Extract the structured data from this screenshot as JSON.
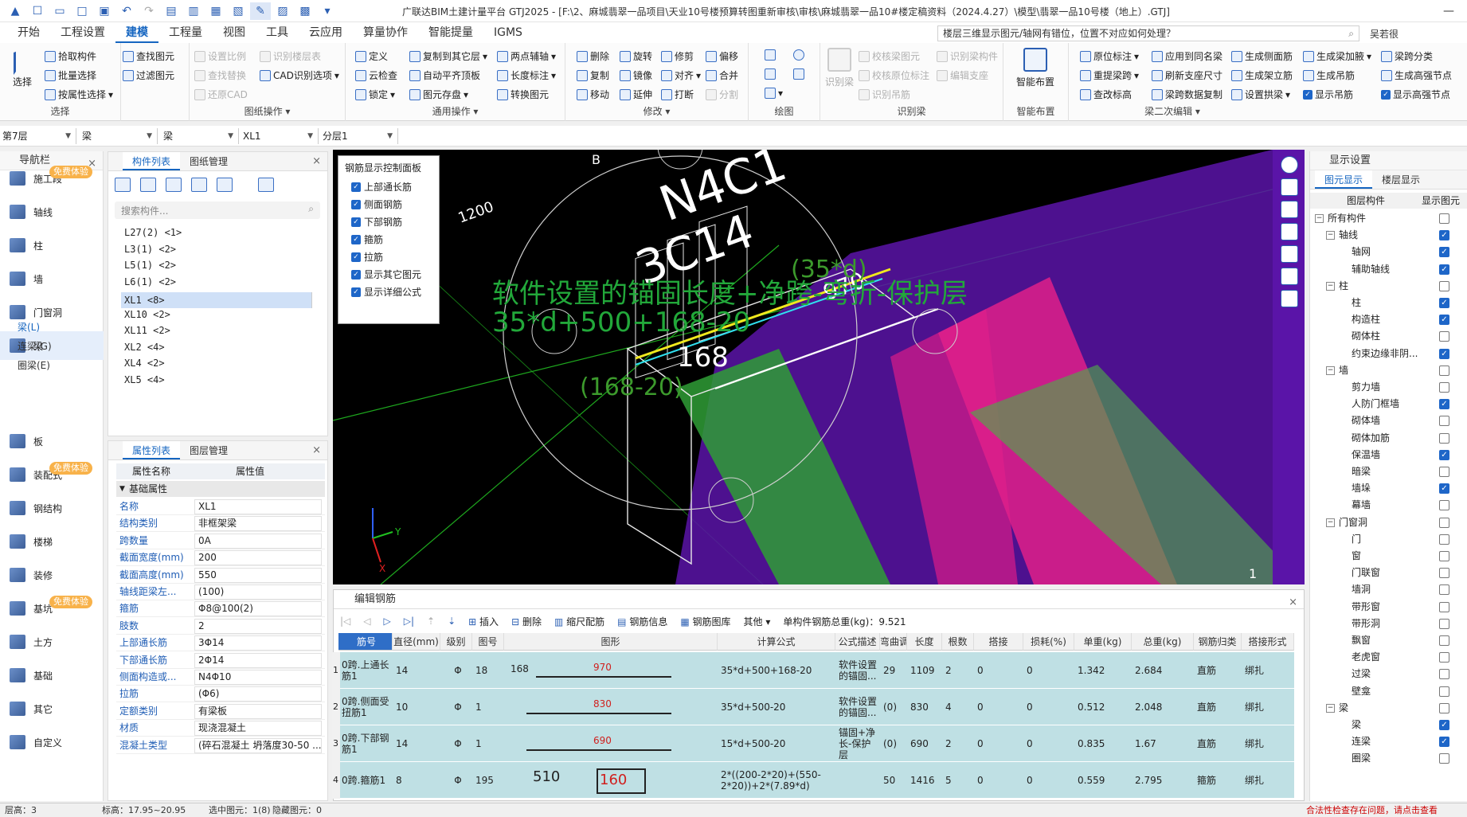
{
  "titlebar": {
    "title": "广联达BIM土建计量平台 GTJ2025 - [F:\\2、麻城翡翠一品项目\\天业10号楼预算转图重新审核\\审核\\麻城翡翠一品10#楼定稿资料（2024.4.27）\\模型\\翡翠一品10号楼（地上）.GTJ]"
  },
  "menubar": {
    "items": [
      "开始",
      "工程设置",
      "建模",
      "工程量",
      "视图",
      "工具",
      "云应用",
      "算量协作",
      "智能提量",
      "IGMS"
    ],
    "notice": "楼层三维显示图元/轴网有错位，位置不对应如何处理？",
    "user": "吴若很"
  },
  "ribbon": {
    "select": {
      "label": "选择",
      "pick": "拾取构件",
      "batch": "批量选择",
      "by_attr": "按属性选择",
      "select": "选择"
    },
    "find": {
      "find": "查找图元",
      "filter": "过滤图元"
    },
    "drawing": {
      "label": "图纸操作",
      "set_scale": "设置比例",
      "find_replace": "查找替换",
      "restore_cad": "还原CAD",
      "recognize_layer": "识别楼层表",
      "cad_option": "CAD识别选项"
    },
    "general": {
      "label": "通用操作",
      "define": "定义",
      "cloud_check": "云检查",
      "lock": "锁定",
      "copy_floor": "复制到其它层",
      "auto_flat": "自动平齐顶板",
      "save_elem": "图元存盘",
      "two_point": "两点辅轴",
      "length_mark": "长度标注",
      "convert": "转换图元"
    },
    "modify": {
      "label": "修改",
      "delete": "删除",
      "rotate": "旋转",
      "trim": "修剪",
      "offset": "偏移",
      "copy": "复制",
      "mirror": "镜像",
      "align": "对齐",
      "merge": "合并",
      "move": "移动",
      "extend": "延伸",
      "break": "打断",
      "split": "分割"
    },
    "draw": {
      "label": "绘图"
    },
    "recognize": {
      "label": "识别梁",
      "rec_beam": "识别梁",
      "check_beam": "校核梁图元",
      "check_origin": "校核原位标注",
      "rec_hanger": "识别吊筋",
      "rec_comp": "识别梁构件",
      "edit_support": "编辑支座"
    },
    "smart": {
      "label": "智能布置",
      "btn": "智能布置"
    },
    "secondary": {
      "label": "梁二次编辑",
      "origin_mark": "原位标注",
      "re_span": "重提梁跨",
      "check_height": "查改标高",
      "apply_same": "应用到同名梁",
      "refresh_support": "刷新支座尺寸",
      "span_copy": "梁跨数据复制",
      "gen_side": "生成侧面筋",
      "gen_column": "生成架立筋",
      "set_arch": "设置拱梁",
      "gen_haunch": "生成梁加腋",
      "gen_hanger": "生成吊筋",
      "show_hanger": "显示吊筋",
      "span_class": "梁跨分类",
      "gen_node": "生成高强节点",
      "show_node": "显示高强节点"
    }
  },
  "selbar": {
    "floor": "第7层",
    "type": "梁",
    "subtype": "梁",
    "component": "XL1",
    "layer": "分层1"
  },
  "nav": {
    "title": "导航栏",
    "items": [
      {
        "label": "施工段",
        "badge": "免费体验"
      },
      {
        "label": "轴线"
      },
      {
        "label": "柱"
      },
      {
        "label": "墙"
      },
      {
        "label": "门窗洞"
      },
      {
        "label": "梁"
      },
      {
        "label": "板"
      },
      {
        "label": "装配式",
        "badge": "免费体验"
      },
      {
        "label": "钢结构"
      },
      {
        "label": "楼梯"
      },
      {
        "label": "装修"
      },
      {
        "label": "基坑",
        "badge": "免费体验"
      },
      {
        "label": "土方"
      },
      {
        "label": "基础"
      },
      {
        "label": "其它"
      },
      {
        "label": "自定义"
      }
    ],
    "sub": [
      "梁(L)",
      "连梁(G)",
      "圈梁(E)"
    ]
  },
  "components": {
    "tab1": "构件列表",
    "tab2": "图纸管理",
    "search": "搜索构件...",
    "items": [
      "L27(2) <1>",
      "L3(1) <2>",
      "L5(1) <2>",
      "L6(1) <2>",
      "XL1 <8>",
      "XL10 <2>",
      "XL11 <2>",
      "XL2 <4>",
      "XL4 <2>",
      "XL5 <4>"
    ]
  },
  "props": {
    "tab1": "属性列表",
    "tab2": "图层管理",
    "col_name": "属性名称",
    "col_value": "属性值",
    "group": "基础属性",
    "rows": [
      {
        "name": "名称",
        "value": "XL1"
      },
      {
        "name": "结构类别",
        "value": "非框架梁"
      },
      {
        "name": "跨数量",
        "value": "0A"
      },
      {
        "name": "截面宽度(mm)",
        "value": "200"
      },
      {
        "name": "截面高度(mm)",
        "value": "550"
      },
      {
        "name": "轴线距梁左...",
        "value": "(100)"
      },
      {
        "name": "箍筋",
        "value": "Φ8@100(2)"
      },
      {
        "name": "肢数",
        "value": "2"
      },
      {
        "name": "上部通长筋",
        "value": "3Φ14"
      },
      {
        "name": "下部通长筋",
        "value": "2Φ14"
      },
      {
        "name": "侧面构造或...",
        "value": "N4Φ10"
      },
      {
        "name": "拉筋",
        "value": "(Φ6)"
      },
      {
        "name": "定额类别",
        "value": "有梁板"
      },
      {
        "name": "材质",
        "value": "现浇混凝土"
      },
      {
        "name": "混凝土类型",
        "value": "(碎石混凝土 坍落度30-50 ..."
      }
    ]
  },
  "viewport": {
    "labels": {
      "b": "B",
      "dim1200": "1200",
      "n4": "N4C1",
      "c14": "3C14",
      "n970": "970",
      "n168": "168",
      "n35d": "(35*d)",
      "n16820": "(168-20)",
      "one": "1"
    },
    "annotation_line1": "软件设置的锚固长度+净跨-弯折-保护层",
    "annotation_line2": "35*d+500+168-20",
    "axis_y": "Y",
    "axis_x": "X",
    "colors": {
      "magenta": "#e0208a",
      "purple": "#6a1ab8",
      "green": "#3fa040",
      "yellow": "#e8e020",
      "cyan": "#30e0f0"
    }
  },
  "rebar_panel": {
    "title": "钢筋显示控制面板",
    "items": [
      "上部通长筋",
      "侧面钢筋",
      "下部钢筋",
      "箍筋",
      "拉筋",
      "显示其它图元",
      "显示详细公式"
    ]
  },
  "editor": {
    "title": "编辑钢筋",
    "tools": {
      "insert": "插入",
      "delete": "删除",
      "scale": "缩尺配筋",
      "info": "钢筋信息",
      "library": "钢筋图库",
      "other": "其他",
      "total": "单构件钢筋总重(kg)：9.521"
    },
    "headers": [
      "筋号",
      "直径(mm)",
      "级别",
      "图号",
      "图形",
      "计算公式",
      "公式描述",
      "弯曲调整",
      "长度",
      "根数",
      "搭接",
      "损耗(%)",
      "单重(kg)",
      "总重(kg)",
      "钢筋归类",
      "搭接形式"
    ],
    "rows": [
      {
        "idx": "1",
        "name": "0跨.上通长筋1",
        "dia": "14",
        "grade": "Φ",
        "fig": "18",
        "s1": "168",
        "s2": "970",
        "formula": "35*d+500+168-20",
        "desc": "软件设置的锚固...",
        "adj": "29",
        "len": "1109",
        "count": "2",
        "lap": "0",
        "loss": "0",
        "unit": "1.342",
        "total": "2.684",
        "cls": "直筋",
        "lapform": "绑扎"
      },
      {
        "idx": "2",
        "name": "0跨.侧面受扭筋1",
        "dia": "10",
        "grade": "Φ",
        "fig": "1",
        "s1": "",
        "s2": "830",
        "formula": "35*d+500-20",
        "desc": "软件设置的锚固...",
        "adj": "(0)",
        "len": "830",
        "count": "4",
        "lap": "0",
        "loss": "0",
        "unit": "0.512",
        "total": "2.048",
        "cls": "直筋",
        "lapform": "绑扎"
      },
      {
        "idx": "3",
        "name": "0跨.下部钢筋1",
        "dia": "14",
        "grade": "Φ",
        "fig": "1",
        "s1": "",
        "s2": "690",
        "formula": "15*d+500-20",
        "desc": "锚固+净长-保护层",
        "adj": "(0)",
        "len": "690",
        "count": "2",
        "lap": "0",
        "loss": "0",
        "unit": "0.835",
        "total": "1.67",
        "cls": "直筋",
        "lapform": "绑扎"
      },
      {
        "idx": "4",
        "name": "0跨.箍筋1",
        "dia": "8",
        "grade": "Φ",
        "fig": "195",
        "s1": "510",
        "s2": "160",
        "formula": "2*((200-2*20)+(550-2*20))+2*(7.89*d)",
        "desc": "",
        "adj": "50",
        "len": "1416",
        "count": "5",
        "lap": "0",
        "loss": "0",
        "unit": "0.559",
        "total": "2.795",
        "cls": "箍筋",
        "lapform": "绑扎"
      }
    ]
  },
  "display": {
    "title": "显示设置",
    "tab1": "图元显示",
    "tab2": "楼层显示",
    "col1": "图层构件",
    "col2": "显示图元",
    "rows": [
      {
        "label": "所有构件",
        "lvl": 0,
        "tog": "−",
        "on": false
      },
      {
        "label": "轴线",
        "lvl": 1,
        "tog": "−",
        "on": true
      },
      {
        "label": "轴网",
        "lvl": 2,
        "on": true
      },
      {
        "label": "辅助轴线",
        "lvl": 2,
        "on": true
      },
      {
        "label": "柱",
        "lvl": 1,
        "tog": "−",
        "on": false
      },
      {
        "label": "柱",
        "lvl": 2,
        "on": true
      },
      {
        "label": "构造柱",
        "lvl": 2,
        "on": true
      },
      {
        "label": "砌体柱",
        "lvl": 2,
        "on": false
      },
      {
        "label": "约束边缘非阴...",
        "lvl": 2,
        "on": true
      },
      {
        "label": "墙",
        "lvl": 1,
        "tog": "−",
        "on": false
      },
      {
        "label": "剪力墙",
        "lvl": 2,
        "on": false
      },
      {
        "label": "人防门框墙",
        "lvl": 2,
        "on": true
      },
      {
        "label": "砌体墙",
        "lvl": 2,
        "on": false
      },
      {
        "label": "砌体加筋",
        "lvl": 2,
        "on": false
      },
      {
        "label": "保温墙",
        "lvl": 2,
        "on": true
      },
      {
        "label": "暗梁",
        "lvl": 2,
        "on": false
      },
      {
        "label": "墙垛",
        "lvl": 2,
        "on": true
      },
      {
        "label": "幕墙",
        "lvl": 2,
        "on": false
      },
      {
        "label": "门窗洞",
        "lvl": 1,
        "tog": "−",
        "on": false
      },
      {
        "label": "门",
        "lvl": 2,
        "on": false
      },
      {
        "label": "窗",
        "lvl": 2,
        "on": false
      },
      {
        "label": "门联窗",
        "lvl": 2,
        "on": false
      },
      {
        "label": "墙洞",
        "lvl": 2,
        "on": false
      },
      {
        "label": "带形窗",
        "lvl": 2,
        "on": false
      },
      {
        "label": "带形洞",
        "lvl": 2,
        "on": false
      },
      {
        "label": "飘窗",
        "lvl": 2,
        "on": false
      },
      {
        "label": "老虎窗",
        "lvl": 2,
        "on": false
      },
      {
        "label": "过梁",
        "lvl": 2,
        "on": false
      },
      {
        "label": "壁龛",
        "lvl": 2,
        "on": false
      },
      {
        "label": "梁",
        "lvl": 1,
        "tog": "−",
        "on": false
      },
      {
        "label": "梁",
        "lvl": 2,
        "on": true
      },
      {
        "label": "连梁",
        "lvl": 2,
        "on": true
      },
      {
        "label": "圈梁",
        "lvl": 2,
        "on": false
      }
    ]
  },
  "status": {
    "layer": "层高：3",
    "elev": "标高：17.95~20.95",
    "selected": "选中图元：1(8)",
    "hidden": "隐藏图元：0",
    "warning": "合法性检查存在问题，请点击查看"
  }
}
